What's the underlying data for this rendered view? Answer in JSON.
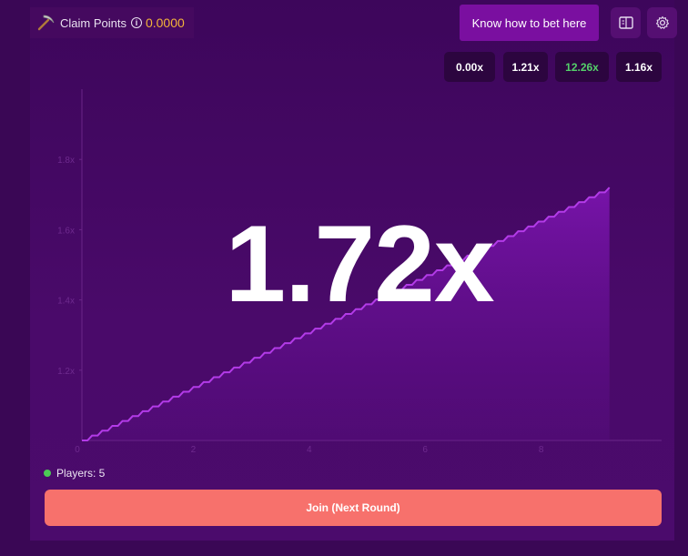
{
  "header": {
    "claim_label": "Claim Points",
    "points": "0.0000",
    "know_button": "Know how to bet here"
  },
  "history": [
    "0.00x",
    "1.21x",
    "12.26x",
    "1.16x"
  ],
  "multiplier": "1.72x",
  "players": "Players: 5",
  "join_button": "Join (Next Round)",
  "colors": {
    "accent_line": "#b33be8",
    "join": "#f7716c",
    "points": "#f3b43a",
    "green": "#54d06a"
  },
  "chart_data": {
    "type": "line",
    "x_ticks": [
      "0",
      "2",
      "4",
      "6",
      "8"
    ],
    "y_ticks": [
      "1.2x",
      "1.4x",
      "1.6x",
      "1.8x"
    ],
    "xlim": [
      0,
      10
    ],
    "ylim": [
      1.0,
      2.0
    ],
    "series": [
      {
        "x": [
          0,
          9.1
        ],
        "y": [
          1.0,
          1.72
        ]
      }
    ]
  }
}
